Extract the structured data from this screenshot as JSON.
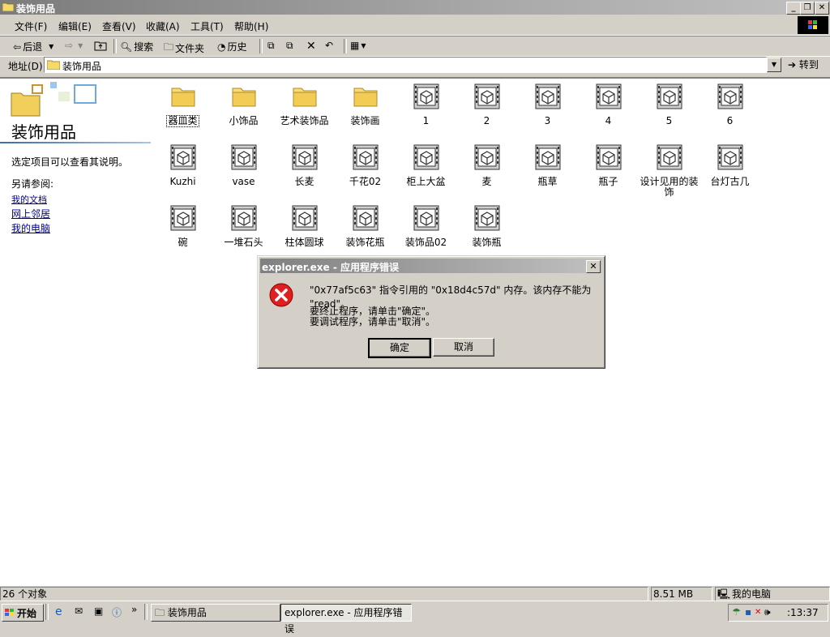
{
  "window": {
    "title": "装饰用品"
  },
  "menu": [
    "文件(F)",
    "编辑(E)",
    "查看(V)",
    "收藏(A)",
    "工具(T)",
    "帮助(H)"
  ],
  "toolbar": {
    "back": "后退",
    "search": "搜索",
    "folders": "文件夹",
    "history": "历史"
  },
  "address": {
    "label": "地址(D)",
    "value": "装饰用品",
    "go": "转到"
  },
  "leftpanel": {
    "title": "装饰用品",
    "description": "选定项目可以查看其说明。",
    "see_also": "另请参阅:",
    "links": [
      "我的文档",
      "网上邻居",
      "我的电脑"
    ]
  },
  "items": [
    {
      "label": "器皿类",
      "type": "folder"
    },
    {
      "label": "小饰品",
      "type": "folder"
    },
    {
      "label": "艺术装饰品",
      "type": "folder"
    },
    {
      "label": "装饰画",
      "type": "folder"
    },
    {
      "label": "1",
      "type": "model"
    },
    {
      "label": "2",
      "type": "model"
    },
    {
      "label": "3",
      "type": "model"
    },
    {
      "label": "4",
      "type": "model"
    },
    {
      "label": "5",
      "type": "model"
    },
    {
      "label": "6",
      "type": "model"
    },
    {
      "label": "Kuzhi",
      "type": "model"
    },
    {
      "label": "vase",
      "type": "model"
    },
    {
      "label": "长麦",
      "type": "model"
    },
    {
      "label": "千花02",
      "type": "model"
    },
    {
      "label": "柜上大盆",
      "type": "model"
    },
    {
      "label": "麦",
      "type": "model"
    },
    {
      "label": "瓶草",
      "type": "model"
    },
    {
      "label": "瓶子",
      "type": "model"
    },
    {
      "label": "设计见用的装饰",
      "type": "model"
    },
    {
      "label": "台灯古几",
      "type": "model"
    },
    {
      "label": "碗",
      "type": "model"
    },
    {
      "label": "一堆石头",
      "type": "model"
    },
    {
      "label": "柱体圆球",
      "type": "model"
    },
    {
      "label": "装饰花瓶",
      "type": "model"
    },
    {
      "label": "装饰品02",
      "type": "model"
    },
    {
      "label": "装饰瓶",
      "type": "model"
    }
  ],
  "dialog": {
    "title": "explorer.exe - 应用程序错误",
    "line1": "\"0x77af5c63\" 指令引用的 \"0x18d4c57d\" 内存。该内存不能为 \"read\"。",
    "line2": "要终止程序，请单击\"确定\"。",
    "line3": "要调试程序，请单击\"取消\"。",
    "ok": "确定",
    "cancel": "取消"
  },
  "status": {
    "count": "26 个对象",
    "size": "8.51 MB",
    "zone": "我的电脑"
  },
  "taskbar": {
    "start": "开始",
    "tasks": [
      "装饰用品",
      "explorer.exe - 应用程序错误"
    ],
    "clock": ":13:37"
  }
}
